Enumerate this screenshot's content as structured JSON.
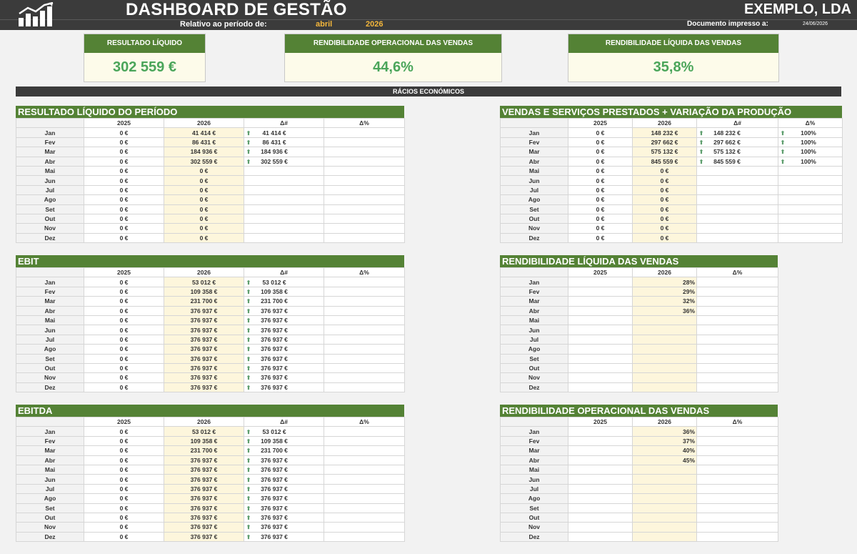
{
  "header": {
    "title": "DASHBOARD DE GESTÃO",
    "company": "EXEMPLO, LDA",
    "period_label": "Relativo ao período de:",
    "month": "abril",
    "year": "2026",
    "printed_label": "Documento impresso a:",
    "printed_date": "24/06/2026"
  },
  "kpis": [
    {
      "label": "RESULTADO LÍQUIDO",
      "value": "302 559 €"
    },
    {
      "label": "RENDIBILIDADE OPERACIONAL DAS VENDAS",
      "value": "44,6%"
    },
    {
      "label": "RENDIBILIDADE LÍQUIDA DAS VENDAS",
      "value": "35,8%"
    }
  ],
  "section_title": "RÁCIOS ECONÓMICOS",
  "colors": {
    "green": "#548235",
    "dark": "#3b3b3b",
    "accent": "#f5b73b",
    "value_green": "#4aa55a"
  },
  "panels": {
    "rl": {
      "title": "RESULTADO LÍQUIDO DO PERÍODO",
      "headers": [
        "",
        "2025",
        "2026",
        "Δ#",
        "Δ%"
      ],
      "rows": [
        [
          "Jan",
          "0 €",
          "41 414 €",
          "41 414 €",
          ""
        ],
        [
          "Fev",
          "0 €",
          "86 431 €",
          "86 431 €",
          ""
        ],
        [
          "Mar",
          "0 €",
          "184 936 €",
          "184 936 €",
          ""
        ],
        [
          "Abr",
          "0 €",
          "302 559 €",
          "302 559 €",
          ""
        ],
        [
          "Mai",
          "0 €",
          "0 €",
          "",
          ""
        ],
        [
          "Jun",
          "0 €",
          "0 €",
          "",
          ""
        ],
        [
          "Jul",
          "0 €",
          "0 €",
          "",
          ""
        ],
        [
          "Ago",
          "0 €",
          "0 €",
          "",
          ""
        ],
        [
          "Set",
          "0 €",
          "0 €",
          "",
          ""
        ],
        [
          "Out",
          "0 €",
          "0 €",
          "",
          ""
        ],
        [
          "Nov",
          "0 €",
          "0 €",
          "",
          ""
        ],
        [
          "Dez",
          "0 €",
          "0 €",
          "",
          ""
        ]
      ]
    },
    "vs": {
      "title": "VENDAS E SERVIÇOS PRESTADOS + VARIAÇÃO DA PRODUÇÃO",
      "headers": [
        "",
        "2025",
        "2026",
        "Δ#",
        "Δ%"
      ],
      "rows": [
        [
          "Jan",
          "0 €",
          "148 232 €",
          "148 232 €",
          "100%"
        ],
        [
          "Fev",
          "0 €",
          "297 662 €",
          "297 662 €",
          "100%"
        ],
        [
          "Mar",
          "0 €",
          "575 132 €",
          "575 132 €",
          "100%"
        ],
        [
          "Abr",
          "0 €",
          "845 559 €",
          "845 559 €",
          "100%"
        ],
        [
          "Mai",
          "0 €",
          "0 €",
          "",
          ""
        ],
        [
          "Jun",
          "0 €",
          "0 €",
          "",
          ""
        ],
        [
          "Jul",
          "0 €",
          "0 €",
          "",
          ""
        ],
        [
          "Ago",
          "0 €",
          "0 €",
          "",
          ""
        ],
        [
          "Set",
          "0 €",
          "0 €",
          "",
          ""
        ],
        [
          "Out",
          "0 €",
          "0 €",
          "",
          ""
        ],
        [
          "Nov",
          "0 €",
          "0 €",
          "",
          ""
        ],
        [
          "Dez",
          "0 €",
          "0 €",
          "",
          ""
        ]
      ]
    },
    "ebit": {
      "title": "EBIT",
      "headers": [
        "",
        "2025",
        "2026",
        "Δ#",
        "Δ%"
      ],
      "rows": [
        [
          "Jan",
          "0 €",
          "53 012 €",
          "53 012 €",
          ""
        ],
        [
          "Fev",
          "0 €",
          "109 358 €",
          "109 358 €",
          ""
        ],
        [
          "Mar",
          "0 €",
          "231 700 €",
          "231 700 €",
          ""
        ],
        [
          "Abr",
          "0 €",
          "376 937 €",
          "376 937 €",
          ""
        ],
        [
          "Mai",
          "0 €",
          "376 937 €",
          "376 937 €",
          ""
        ],
        [
          "Jun",
          "0 €",
          "376 937 €",
          "376 937 €",
          ""
        ],
        [
          "Jul",
          "0 €",
          "376 937 €",
          "376 937 €",
          ""
        ],
        [
          "Ago",
          "0 €",
          "376 937 €",
          "376 937 €",
          ""
        ],
        [
          "Set",
          "0 €",
          "376 937 €",
          "376 937 €",
          ""
        ],
        [
          "Out",
          "0 €",
          "376 937 €",
          "376 937 €",
          ""
        ],
        [
          "Nov",
          "0 €",
          "376 937 €",
          "376 937 €",
          ""
        ],
        [
          "Dez",
          "0 €",
          "376 937 €",
          "376 937 €",
          ""
        ]
      ]
    },
    "rlv": {
      "title": "RENDIBILIDADE LÍQUIDA DAS VENDAS",
      "headers": [
        "",
        "2025",
        "2026",
        "Δ%"
      ],
      "rows": [
        [
          "Jan",
          "",
          "28%",
          ""
        ],
        [
          "Fev",
          "",
          "29%",
          ""
        ],
        [
          "Mar",
          "",
          "32%",
          ""
        ],
        [
          "Abr",
          "",
          "36%",
          ""
        ],
        [
          "Mai",
          "",
          "",
          ""
        ],
        [
          "Jun",
          "",
          "",
          ""
        ],
        [
          "Jul",
          "",
          "",
          ""
        ],
        [
          "Ago",
          "",
          "",
          ""
        ],
        [
          "Set",
          "",
          "",
          ""
        ],
        [
          "Out",
          "",
          "",
          ""
        ],
        [
          "Nov",
          "",
          "",
          ""
        ],
        [
          "Dez",
          "",
          "",
          ""
        ]
      ]
    },
    "ebitda": {
      "title": "EBITDA",
      "headers": [
        "",
        "2025",
        "2026",
        "Δ#",
        "Δ%"
      ],
      "rows": [
        [
          "Jan",
          "0 €",
          "53 012 €",
          "53 012 €",
          ""
        ],
        [
          "Fev",
          "0 €",
          "109 358 €",
          "109 358 €",
          ""
        ],
        [
          "Mar",
          "0 €",
          "231 700 €",
          "231 700 €",
          ""
        ],
        [
          "Abr",
          "0 €",
          "376 937 €",
          "376 937 €",
          ""
        ],
        [
          "Mai",
          "0 €",
          "376 937 €",
          "376 937 €",
          ""
        ],
        [
          "Jun",
          "0 €",
          "376 937 €",
          "376 937 €",
          ""
        ],
        [
          "Jul",
          "0 €",
          "376 937 €",
          "376 937 €",
          ""
        ],
        [
          "Ago",
          "0 €",
          "376 937 €",
          "376 937 €",
          ""
        ],
        [
          "Set",
          "0 €",
          "376 937 €",
          "376 937 €",
          ""
        ],
        [
          "Out",
          "0 €",
          "376 937 €",
          "376 937 €",
          ""
        ],
        [
          "Nov",
          "0 €",
          "376 937 €",
          "376 937 €",
          ""
        ],
        [
          "Dez",
          "0 €",
          "376 937 €",
          "376 937 €",
          ""
        ]
      ]
    },
    "rov": {
      "title": "RENDIBILIDADE OPERACIONAL DAS VENDAS",
      "headers": [
        "",
        "2025",
        "2026",
        "Δ%"
      ],
      "rows": [
        [
          "Jan",
          "",
          "36%",
          ""
        ],
        [
          "Fev",
          "",
          "37%",
          ""
        ],
        [
          "Mar",
          "",
          "40%",
          ""
        ],
        [
          "Abr",
          "",
          "45%",
          ""
        ],
        [
          "Mai",
          "",
          "",
          ""
        ],
        [
          "Jun",
          "",
          "",
          ""
        ],
        [
          "Jul",
          "",
          "",
          ""
        ],
        [
          "Ago",
          "",
          "",
          ""
        ],
        [
          "Set",
          "",
          "",
          ""
        ],
        [
          "Out",
          "",
          "",
          ""
        ],
        [
          "Nov",
          "",
          "",
          ""
        ],
        [
          "Dez",
          "",
          "",
          ""
        ]
      ]
    }
  }
}
